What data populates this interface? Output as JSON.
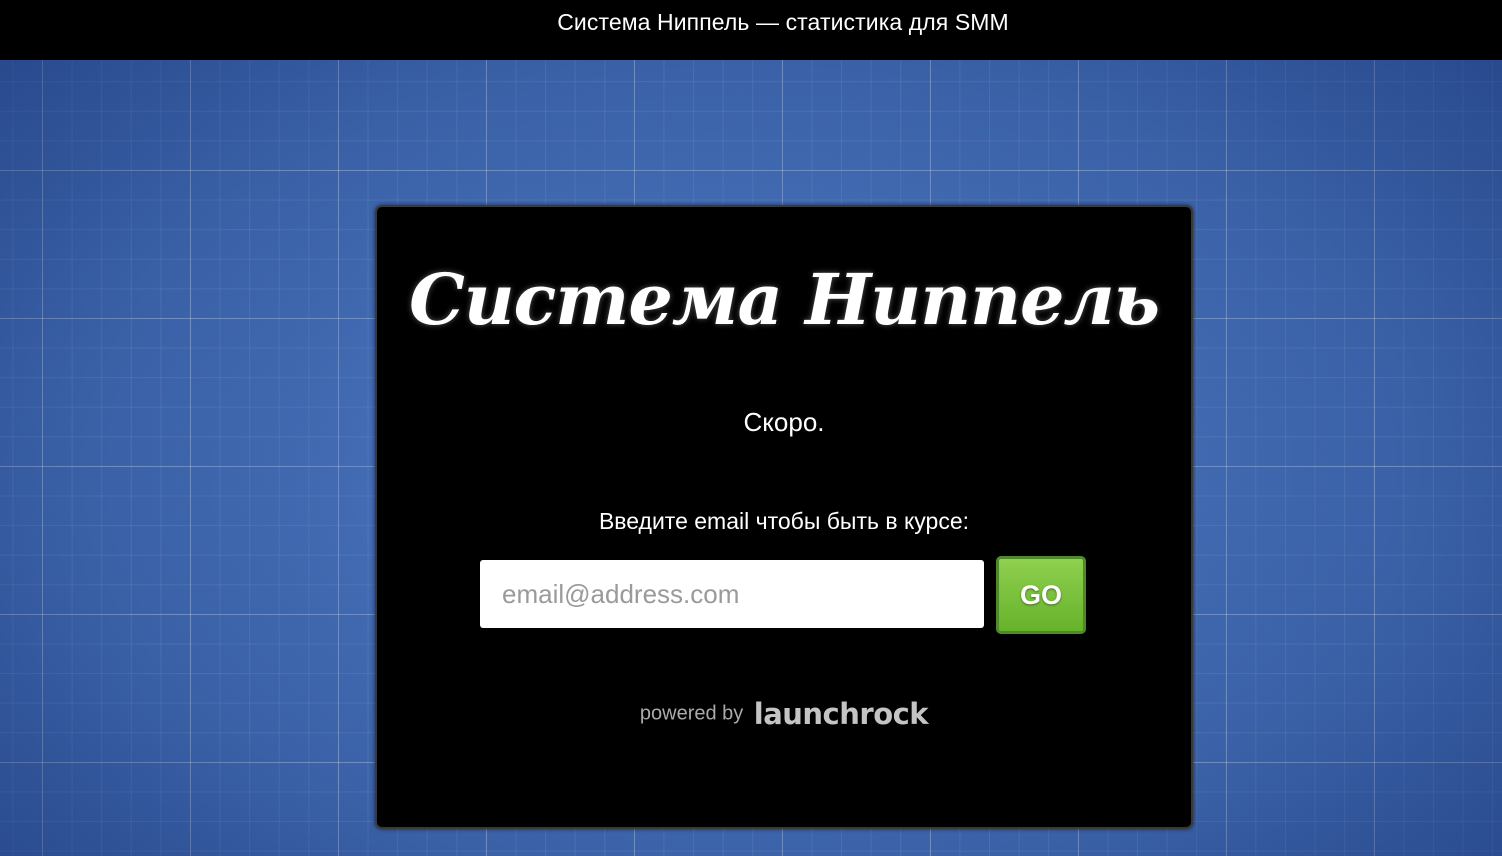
{
  "header": {
    "title": "Система Ниппель — статистика для SMM"
  },
  "card": {
    "logo_text": "Система Ниппель",
    "coming_soon": "Скоро.",
    "prompt": "Введите email чтобы быть в курсе:",
    "email": {
      "value": "",
      "placeholder": "email@address.com"
    },
    "go_label": "GO",
    "powered_by": "powered by",
    "brand": "launchrock"
  },
  "colors": {
    "background": "#3b62a8",
    "card": "#000000",
    "go_button": "#76c13a"
  }
}
